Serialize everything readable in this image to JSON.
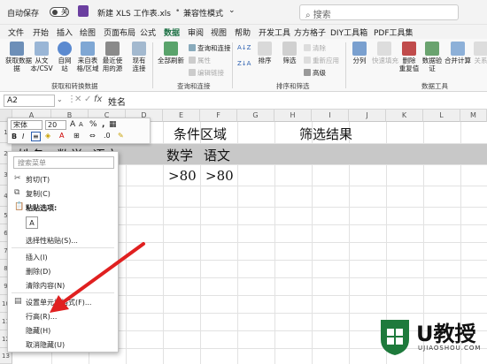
{
  "titlebar": {
    "autosave_label": "自动保存",
    "autosave_state": "关",
    "filename": "新建 XLS 工作表.xls",
    "mode": "兼容性模式",
    "search_placeholder": "搜索"
  },
  "tabs": [
    "文件",
    "开始",
    "插入",
    "绘图",
    "页面布局",
    "公式",
    "数据",
    "审阅",
    "视图",
    "帮助",
    "开发工具",
    "方方格子",
    "DIY工具箱",
    "PDF工具集"
  ],
  "active_tab": "数据",
  "ribbon": {
    "get_data": {
      "btn1": "获取数据",
      "btn1b": "据",
      "btn2": "从文",
      "btn2b": "本/CSV",
      "btn3": "自网",
      "btn3b": "站",
      "btn4": "来自表格/区域",
      "btn4a": "来自表",
      "btn4b": "格/区域",
      "btn5": "最近使",
      "btn5b": "用的源",
      "btn6": "现有",
      "btn6b": "连接",
      "group": "获取和转换数据"
    },
    "queries": {
      "refresh": "全部刷新",
      "q1": "查询和连接",
      "q2": "属性",
      "q3": "编辑链接",
      "group": "查询和连接"
    },
    "sort_filter": {
      "sort": "排序",
      "filter": "筛选",
      "clear": "清除",
      "reapply": "重新应用",
      "advanced": "高级",
      "group": "排序和筛选"
    },
    "data_tools": {
      "split": "分列",
      "fill": "快速填充",
      "remove_dup": "删除",
      "remove_dup2": "重复值",
      "validate": "数据验",
      "validate2": "证",
      "consolidate": "合并计算",
      "relations": "关系",
      "group": "数据工具"
    }
  },
  "formula_bar": {
    "name_box": "A2",
    "fx": "fx",
    "value": "姓名"
  },
  "columns": [
    "A",
    "B",
    "C",
    "D",
    "E",
    "F",
    "G",
    "H",
    "I",
    "J",
    "K",
    "L",
    "M"
  ],
  "rows": [
    "1",
    "2",
    "3",
    "4",
    "5",
    "6",
    "7",
    "8",
    "9",
    "10",
    "11",
    "12",
    "13",
    "14",
    "15",
    "16",
    "17"
  ],
  "cells": {
    "condition_header": "条件区域",
    "result_header": "筛选结果",
    "row2_a": "姓名",
    "row2_b": "数学",
    "row2_c": "语文",
    "e2": "数学",
    "f2": "语文",
    "e3": ">80",
    "f3": ">80"
  },
  "mini_toolbar": {
    "font": "宋体",
    "size": "20",
    "bold": "B",
    "italic": "I"
  },
  "context_menu": {
    "search_placeholder": "搜索菜单",
    "items": [
      "剪切(T)",
      "复制(C)",
      "粘贴选项:",
      "",
      "选择性粘贴(S)...",
      "插入(I)",
      "删除(D)",
      "清除内容(N)",
      "设置单元格格式(F)...",
      "行高(R)...",
      "隐藏(H)",
      "取消隐藏(U)"
    ]
  },
  "watermark": {
    "text": "U教授",
    "url": "UJIAOSHOU.COM"
  },
  "colors": {
    "accent": "#1e7145",
    "arrow": "#e02020",
    "header_fill": "#c8c8c8"
  }
}
